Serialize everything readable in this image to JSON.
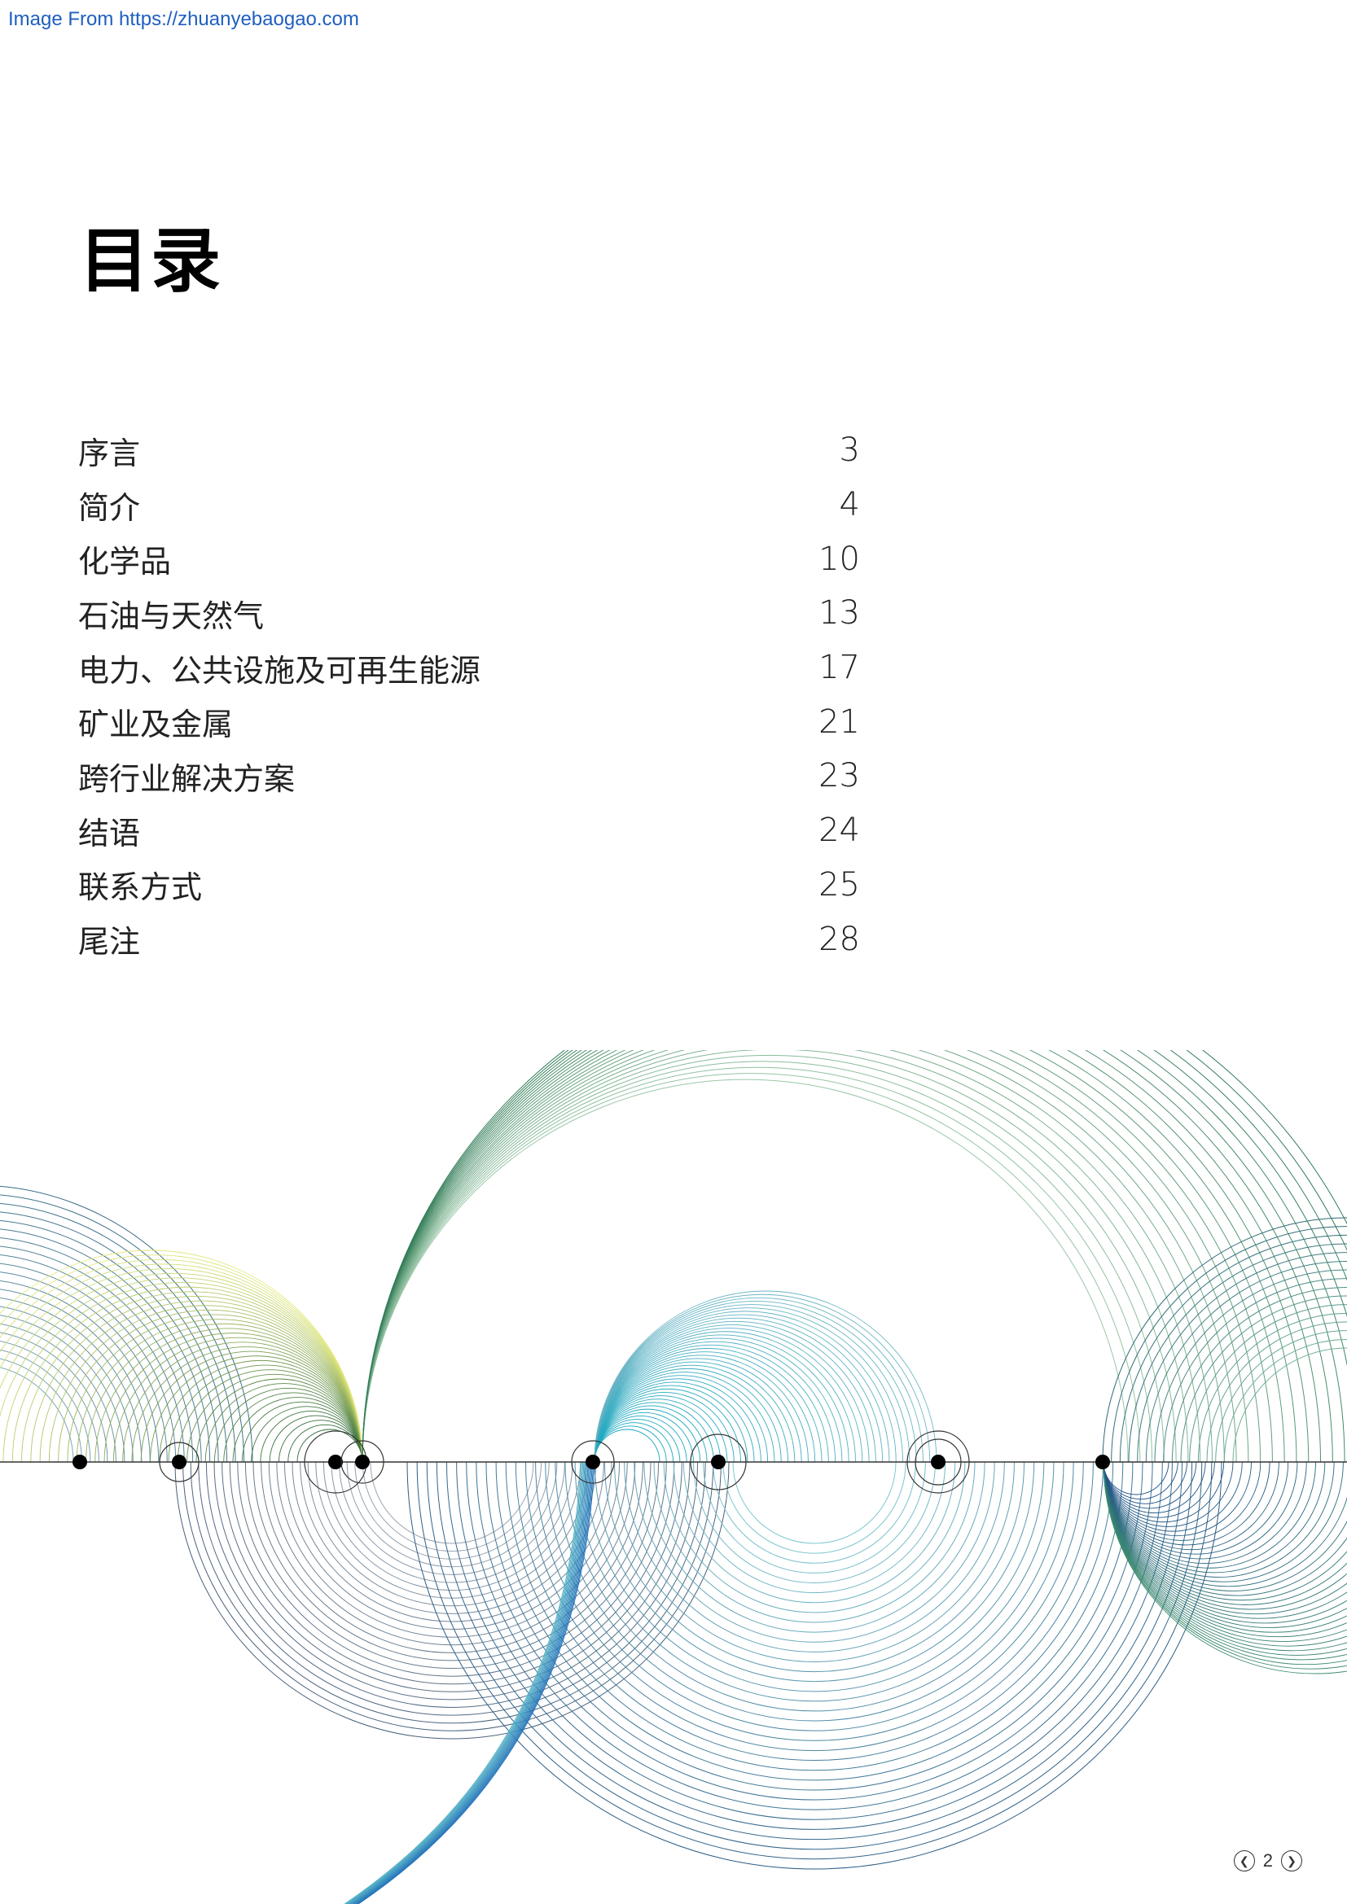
{
  "watermark": "Image From https://zhuanyebaogao.com",
  "title": "目录",
  "toc": [
    {
      "label": "序言",
      "page": "3"
    },
    {
      "label": "简介",
      "page": "4"
    },
    {
      "label": "化学品",
      "page": "10"
    },
    {
      "label": "石油与天然气",
      "page": "13"
    },
    {
      "label": "电力、公共设施及可再生能源",
      "page": "17"
    },
    {
      "label": "矿业及金属",
      "page": "21"
    },
    {
      "label": "跨行业解决方案",
      "page": "23"
    },
    {
      "label": "结语",
      "page": "24"
    },
    {
      "label": "联系方式",
      "page": "25"
    },
    {
      "label": "尾注",
      "page": "28"
    }
  ],
  "pager": {
    "page": "2",
    "prev_icon": "chevron-left-icon",
    "next_icon": "chevron-right-icon"
  }
}
